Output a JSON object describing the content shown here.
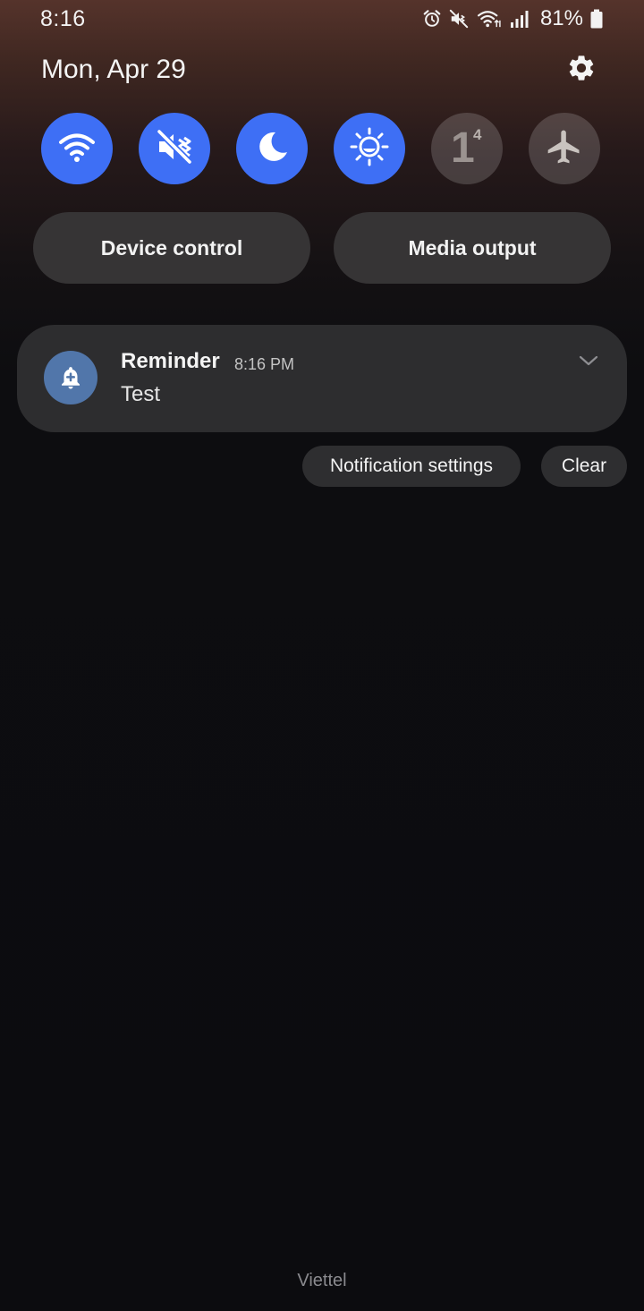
{
  "status_bar": {
    "time": "8:16",
    "battery_percent": "81%",
    "icons": [
      "alarm-icon",
      "mute-icon",
      "wifi-data-icon",
      "signal-icon",
      "battery-icon"
    ]
  },
  "header": {
    "date": "Mon, Apr 29",
    "settings_icon": "gear-icon"
  },
  "quick_toggles": [
    {
      "name": "wifi",
      "icon": "wifi-icon",
      "state": "on"
    },
    {
      "name": "mute",
      "icon": "mute-icon",
      "state": "on"
    },
    {
      "name": "night-mode",
      "icon": "moon-icon",
      "state": "on"
    },
    {
      "name": "eye-comfort",
      "icon": "eye-comfort-icon",
      "state": "on"
    },
    {
      "name": "sim",
      "icon": "sim-icon",
      "state": "off",
      "label": "1",
      "sup": "4"
    },
    {
      "name": "airplane-mode",
      "icon": "airplane-icon",
      "state": "off"
    }
  ],
  "pills": {
    "device_control": "Device control",
    "media_output": "Media output"
  },
  "notification": {
    "app_icon": "reminder-bell-icon",
    "title": "Reminder",
    "time": "8:16 PM",
    "body": "Test"
  },
  "actions": {
    "notification_settings": "Notification settings",
    "clear": "Clear"
  },
  "carrier": "Viettel",
  "colors": {
    "toggle_on": "#3e6ff5",
    "toggle_off": "#4a4446",
    "notification_icon": "#5176aa"
  }
}
